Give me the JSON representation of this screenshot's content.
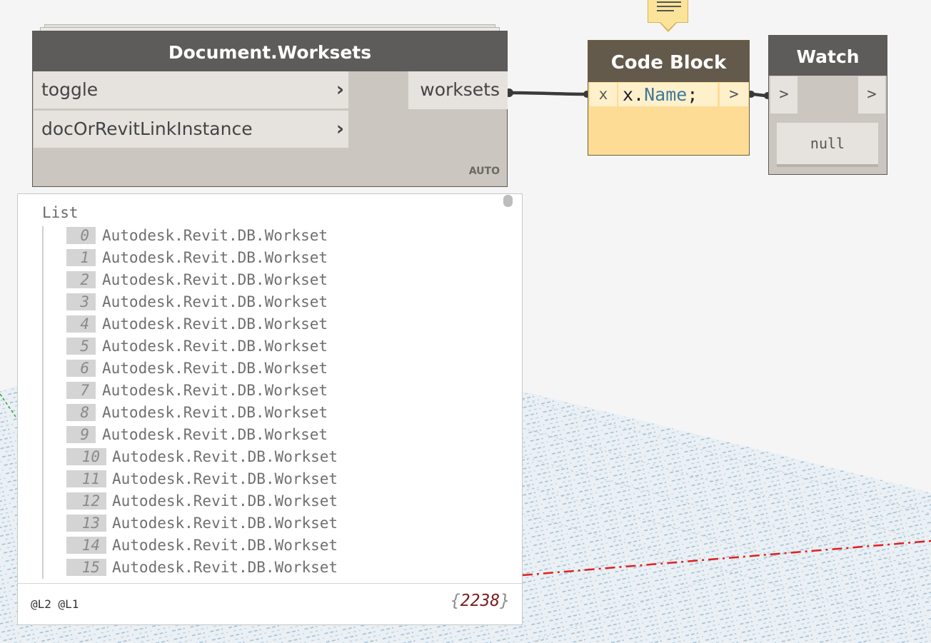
{
  "worksets_node": {
    "title": "Document.Worksets",
    "inputs": [
      {
        "label": "toggle",
        "chevron": "›"
      },
      {
        "label": "docOrRevitLinkInstance",
        "chevron": "›"
      }
    ],
    "output": "worksets",
    "lacing": "AUTO"
  },
  "preview": {
    "title": "List",
    "items": [
      {
        "index": "0",
        "value": "Autodesk.Revit.DB.Workset"
      },
      {
        "index": "1",
        "value": "Autodesk.Revit.DB.Workset"
      },
      {
        "index": "2",
        "value": "Autodesk.Revit.DB.Workset"
      },
      {
        "index": "3",
        "value": "Autodesk.Revit.DB.Workset"
      },
      {
        "index": "4",
        "value": "Autodesk.Revit.DB.Workset"
      },
      {
        "index": "5",
        "value": "Autodesk.Revit.DB.Workset"
      },
      {
        "index": "6",
        "value": "Autodesk.Revit.DB.Workset"
      },
      {
        "index": "7",
        "value": "Autodesk.Revit.DB.Workset"
      },
      {
        "index": "8",
        "value": "Autodesk.Revit.DB.Workset"
      },
      {
        "index": "9",
        "value": "Autodesk.Revit.DB.Workset"
      },
      {
        "index": "10",
        "value": "Autodesk.Revit.DB.Workset"
      },
      {
        "index": "11",
        "value": "Autodesk.Revit.DB.Workset"
      },
      {
        "index": "12",
        "value": "Autodesk.Revit.DB.Workset"
      },
      {
        "index": "13",
        "value": "Autodesk.Revit.DB.Workset"
      },
      {
        "index": "14",
        "value": "Autodesk.Revit.DB.Workset"
      },
      {
        "index": "15",
        "value": "Autodesk.Revit.DB.Workset"
      }
    ],
    "levels": "@L2 @L1",
    "count_open": "{",
    "count": "2238",
    "count_close": "}"
  },
  "code_block": {
    "title": "Code Block",
    "input": "x",
    "code_var": "x.",
    "code_prop": "Name",
    "code_end": ";",
    "output": ">",
    "note_icon": "note-icon"
  },
  "watch_node": {
    "title": "Watch",
    "input": ">",
    "output": ">",
    "value": "null"
  },
  "colors": {
    "node_header": "#5e5c5a",
    "node_body": "#cbc6bf",
    "code_block_body": "#fddc95",
    "code_block_header": "#635a4b",
    "wire": "#3a3a3a",
    "canvas": "#f5f5f5",
    "background_geometry": "#a9c3d6",
    "dashed_line": "#e02020"
  }
}
